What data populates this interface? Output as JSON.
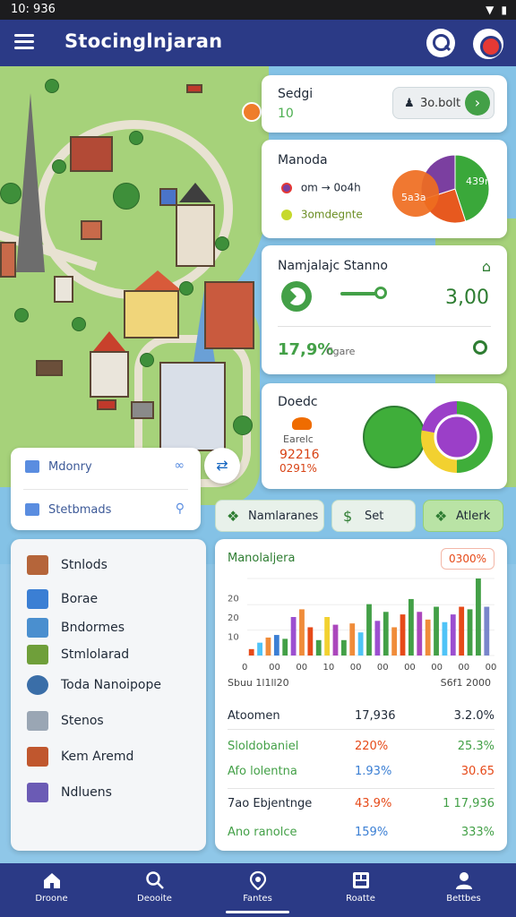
{
  "status_bar": {
    "time": "10: 936"
  },
  "app_bar": {
    "title": "Stocinglnjaran"
  },
  "score_card": {
    "title": "Sedgi",
    "value": "10",
    "chip_label": "3o.bolt"
  },
  "manoda_card": {
    "title": "Manoda",
    "legend": [
      {
        "label": "om → 0o4h",
        "color": "#7b3fa0"
      },
      {
        "label": "3omdegnte",
        "color": "#c6d92c"
      }
    ],
    "chart_data": {
      "type": "pie",
      "categories": [
        "A",
        "B",
        "C"
      ],
      "values": [
        45,
        25,
        30
      ],
      "labels": [
        "439n",
        "5a3a"
      ],
      "colors": [
        "#3aa83a",
        "#e7591f",
        "#7b3fa0"
      ]
    }
  },
  "stats_card": {
    "title": "Namjalajc Stanno",
    "value": "3,00",
    "percent": "17,9%",
    "subtext": "Cgare"
  },
  "donut_card": {
    "title": "Doedc",
    "label": "Earelc",
    "value": "92216",
    "percent": "0291%",
    "chart_data": {
      "type": "pie",
      "categories": [
        "Green",
        "Yellow",
        "Purple"
      ],
      "values": [
        50,
        28,
        22
      ],
      "colors": [
        "#3fae3a",
        "#f2d130",
        "#9b3fc8"
      ]
    }
  },
  "search_card": {
    "row1": "Mdonry",
    "row2": "Stetbmads"
  },
  "chips": [
    "Namlaranes",
    "Set",
    "Atlerk"
  ],
  "list": [
    {
      "label": "Stnlods",
      "color": "#b5653a"
    },
    {
      "label": "Borae",
      "color": "#3b7fd4"
    },
    {
      "label": "Bndormes",
      "color": "#4a8fcf"
    },
    {
      "label": "Stmlolarad",
      "color": "#6f9f3a"
    },
    {
      "label": "Toda Nanoipope",
      "color": "#3a6ea8"
    },
    {
      "label": "Stenos",
      "color": "#9aa6b4"
    },
    {
      "label": "Kem Aremd",
      "color": "#c0572e"
    },
    {
      "label": "Ndluens",
      "color": "#6b5bb5"
    }
  ],
  "chart_card": {
    "title": "Manolaljera",
    "badge": "0300%",
    "caption_left": "Sbuu  1l1ll20",
    "caption_right": "S6f1  2000",
    "chart_data": {
      "type": "bar",
      "y_tick_labels": [
        "20",
        "20",
        "10"
      ],
      "x_tick_labels": [
        "0",
        "00",
        "00",
        "10",
        "00",
        "00",
        "00",
        "00",
        "00",
        "00"
      ],
      "values": [
        5,
        10,
        14,
        16,
        13,
        30,
        36,
        22,
        12,
        30,
        24,
        12,
        25,
        18,
        40,
        27,
        34,
        22,
        32,
        44,
        34,
        28,
        38,
        26,
        32,
        38,
        36,
        60,
        38
      ],
      "colors": [
        "#e64a19",
        "#4fc3f7",
        "#f08c3a",
        "#3b7fd4",
        "#43a047",
        "#9c4fd0",
        "#f08c3a",
        "#e64a19",
        "#43a047",
        "#f2d130",
        "#ab47bc",
        "#43a047",
        "#f08c3a",
        "#4fc3f7",
        "#43a047",
        "#9c4fd0",
        "#43a047",
        "#f08c3a",
        "#e64a19",
        "#43a047",
        "#ab47bc",
        "#f08c3a",
        "#43a047",
        "#4fc3f7",
        "#9c4fd0",
        "#e64a19",
        "#43a047",
        "#43a047",
        "#7986cb"
      ]
    }
  },
  "table": [
    {
      "name": "Atoomen",
      "a": "17,936",
      "b": "3.2.0%",
      "color": "#222222"
    },
    {
      "name": "Sloldobaniel",
      "a": "220%",
      "b": "25.3%",
      "color": "#43a047",
      "color_a": "#e64a19"
    },
    {
      "name": "Afo lolentna",
      "a": "1.93%",
      "b": "30.65",
      "color": "#43a047",
      "color_a": "#3b7fd4",
      "color_b": "#e64a19"
    },
    {
      "name": "7ao Ebjentnge",
      "a": "43.9%",
      "b": "1 17,936",
      "color": "#222222",
      "color_a": "#e64a19",
      "color_b": "#43a047"
    },
    {
      "name": "Ano ranolce",
      "a": "159%",
      "b": "333%",
      "color": "#43a047",
      "color_a": "#3b7fd4"
    }
  ],
  "nav": [
    {
      "label": "Droone",
      "icon": "home-icon"
    },
    {
      "label": "Deooite",
      "icon": "search-icon"
    },
    {
      "label": "Fantes",
      "icon": "map-icon"
    },
    {
      "label": "Roatte",
      "icon": "grid-icon"
    },
    {
      "label": "Bettbes",
      "icon": "person-icon"
    }
  ]
}
